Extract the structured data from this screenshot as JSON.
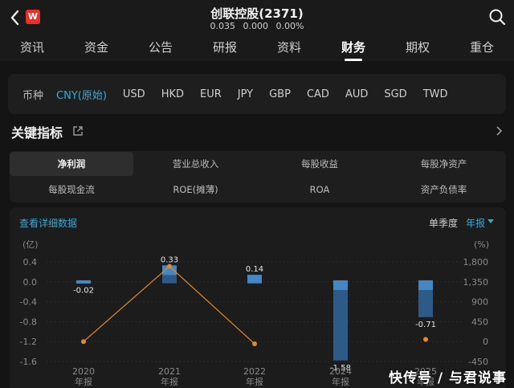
{
  "header": {
    "title": "创联控股(2371)",
    "price": "0.035",
    "change": "0.000",
    "change_pct": "0.00%",
    "logo_text": "W"
  },
  "tabs": [
    {
      "label": "资讯"
    },
    {
      "label": "资金"
    },
    {
      "label": "公告"
    },
    {
      "label": "研报"
    },
    {
      "label": "资料"
    },
    {
      "label": "财务",
      "active": true
    },
    {
      "label": "期权"
    },
    {
      "label": "重仓"
    }
  ],
  "currency": {
    "label": "币种",
    "options": [
      "CNY(原始)",
      "USD",
      "HKD",
      "EUR",
      "JPY",
      "GBP",
      "CAD",
      "AUD",
      "SGD",
      "TWD"
    ],
    "selected": "CNY(原始)"
  },
  "key_metrics": {
    "title": "关键指标",
    "items": [
      "净利润",
      "营业总收入",
      "每股收益",
      "每股净资产",
      "每股现金流",
      "ROE(摊薄)",
      "ROA",
      "资产负债率"
    ],
    "selected": "净利润"
  },
  "chart_header": {
    "detail_link": "查看详细数据",
    "period": "单季度",
    "report_type": "年报"
  },
  "chart_data": {
    "type": "bar",
    "categories": [
      "2020",
      "2021",
      "2022",
      "2024",
      "2025"
    ],
    "category_sublabel": "年报",
    "values": [
      -0.02,
      0.33,
      0.14,
      -1.58,
      -0.71
    ],
    "value_labels": [
      "-0.02",
      "0.33",
      "0.14",
      "-1.58",
      "-0.71"
    ],
    "line_values": [
      0,
      1700,
      -50,
      null,
      50
    ],
    "y_left_unit": "(亿)",
    "y_right_unit": "(%)",
    "y_left_ticks": [
      "0.4",
      "0.0",
      "-0.4",
      "-0.8",
      "-1.2",
      "-1.6"
    ],
    "y_right_ticks": [
      "1,800",
      "1,350",
      "900",
      "450",
      "0",
      "-450"
    ],
    "ylim_left": [
      -1.6,
      0.4
    ],
    "ylim_right": [
      -450,
      1800
    ],
    "colors": {
      "bar": "#2d5a86",
      "bar_highlight": "#4a8fd0",
      "line": "#e08a28",
      "point": "#e08a28"
    }
  },
  "watermark": "快传号 / 与君说事"
}
